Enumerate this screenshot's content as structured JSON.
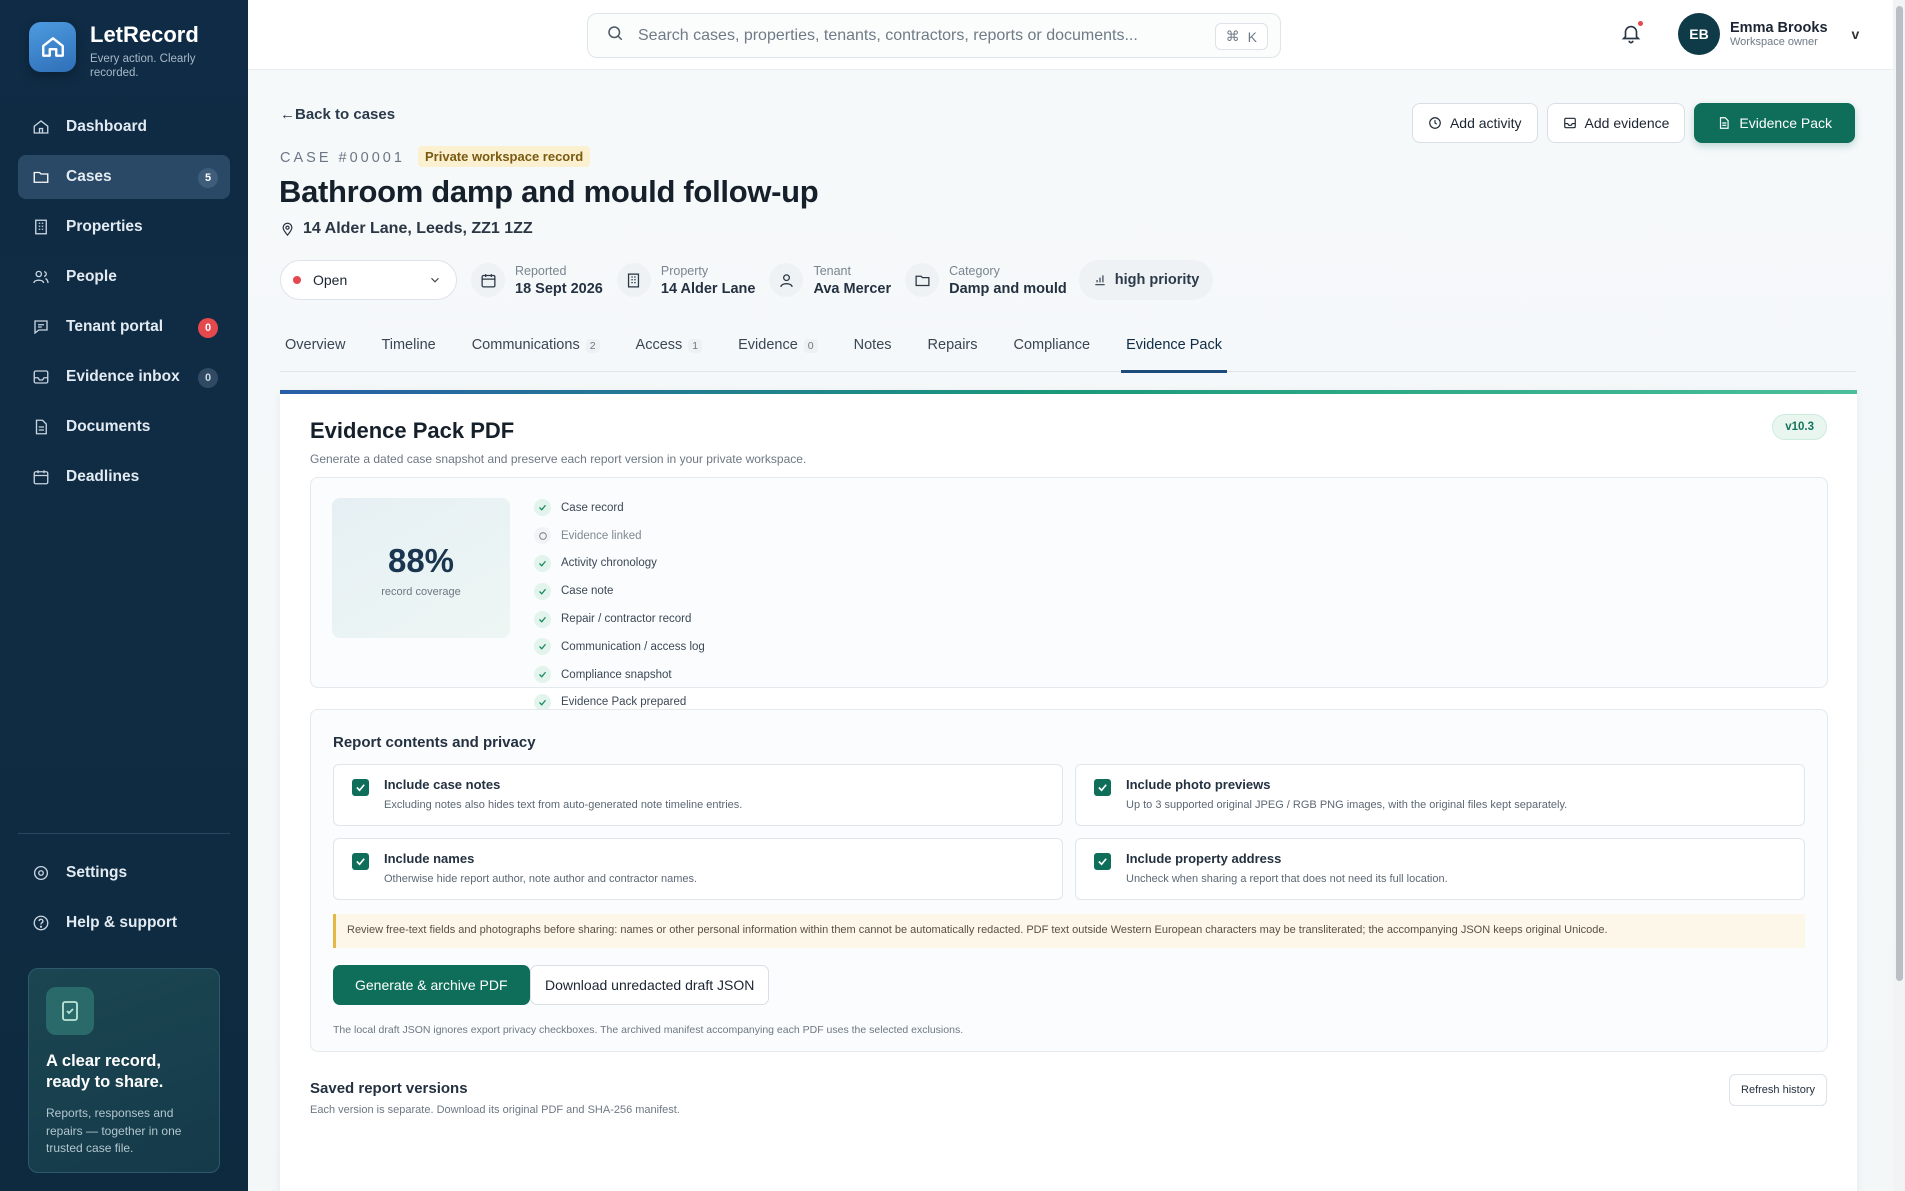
{
  "brand": {
    "name": "LetRecord",
    "tagline": "Every action. Clearly recorded."
  },
  "sidebar": {
    "items": [
      {
        "label": "Dashboard",
        "icon": "home-icon"
      },
      {
        "label": "Cases",
        "icon": "folder-icon",
        "count": "5",
        "active": true
      },
      {
        "label": "Properties",
        "icon": "building-icon"
      },
      {
        "label": "People",
        "icon": "users-icon"
      },
      {
        "label": "Tenant portal",
        "icon": "message-icon",
        "count": "0"
      },
      {
        "label": "Evidence inbox",
        "icon": "inbox-icon",
        "count": "0"
      },
      {
        "label": "Documents",
        "icon": "document-icon"
      },
      {
        "label": "Deadlines",
        "icon": "calendar-icon"
      }
    ],
    "footer_items": [
      {
        "label": "Settings",
        "icon": "gear-icon"
      },
      {
        "label": "Help & support",
        "icon": "help-icon"
      }
    ],
    "promo": {
      "title": "A clear record, ready to share.",
      "text": "Reports, responses and repairs — together in one trusted case file."
    }
  },
  "topbar": {
    "search_placeholder": "Search cases, properties, tenants, contractors, reports or documents...",
    "shortcut_symbol": "⌘",
    "shortcut_key": "K",
    "user": {
      "initials": "EB",
      "name": "Emma Brooks",
      "role": "Workspace owner",
      "caret": "v"
    }
  },
  "page": {
    "back_label": "Back to cases",
    "actions": {
      "add_activity": "Add activity",
      "add_evidence": "Add evidence",
      "evidence_pack": "Evidence Pack"
    },
    "case_id": "CASE #00001",
    "case_badge": "Private workspace record",
    "title": "Bathroom damp and mould follow-up",
    "address": "14 Alder Lane, Leeds, ZZ1 1ZZ",
    "status": "Open",
    "meta": {
      "reported_label": "Reported",
      "reported_value": "18 Sept 2026",
      "property_label": "Property",
      "property_value": "14 Alder Lane",
      "tenant_label": "Tenant",
      "tenant_value": "Ava Mercer",
      "category_label": "Category",
      "category_value": "Damp and mould"
    },
    "priority": "high priority",
    "tabs": [
      {
        "label": "Overview"
      },
      {
        "label": "Timeline"
      },
      {
        "label": "Communications",
        "count": "2"
      },
      {
        "label": "Access",
        "count": "1"
      },
      {
        "label": "Evidence",
        "count": "0"
      },
      {
        "label": "Notes"
      },
      {
        "label": "Repairs"
      },
      {
        "label": "Compliance"
      },
      {
        "label": "Evidence Pack",
        "active": true
      }
    ]
  },
  "pack": {
    "title": "Evidence Pack PDF",
    "subtitle": "Generate a dated case snapshot and preserve each report version in your private workspace.",
    "version": "v10.3",
    "coverage_pct": "88%",
    "coverage_label": "record coverage",
    "checklist": [
      {
        "label": "Case record",
        "done": true
      },
      {
        "label": "Evidence linked",
        "done": false
      },
      {
        "label": "Activity chronology",
        "done": true
      },
      {
        "label": "Case note",
        "done": true
      },
      {
        "label": "Repair / contractor record",
        "done": true
      },
      {
        "label": "Communication / access log",
        "done": true
      },
      {
        "label": "Compliance snapshot",
        "done": true
      },
      {
        "label": "Evidence Pack prepared",
        "done": true
      }
    ],
    "privacy": {
      "title": "Report contents and privacy",
      "options": [
        {
          "title": "Include case notes",
          "desc": "Excluding notes also hides text from auto-generated note timeline entries."
        },
        {
          "title": "Include photo previews",
          "desc": "Up to 3 supported original JPEG / RGB PNG images, with the original files kept separately."
        },
        {
          "title": "Include names",
          "desc": "Otherwise hide report author, note author and contractor names."
        },
        {
          "title": "Include property address",
          "desc": "Uncheck when sharing a report that does not need its full location."
        }
      ],
      "warning": "Review free-text fields and photographs before sharing: names or other personal information within them cannot be automatically redacted. PDF text outside Western European characters may be transliterated; the accompanying JSON keeps original Unicode.",
      "generate_label": "Generate & archive PDF",
      "download_label": "Download unredacted draft JSON",
      "note": "The local draft JSON ignores export privacy checkboxes. The archived manifest accompanying each PDF uses the selected exclusions."
    },
    "saved": {
      "title": "Saved report versions",
      "subtitle": "Each version is separate. Download its original PDF and SHA-256 manifest.",
      "refresh_label": "Refresh history"
    }
  },
  "colors": {
    "sidebar_bg": "#0f2b45",
    "accent": "#0e6e5a",
    "alert": "#e5484d",
    "badge_bg": "#fbf0cf"
  }
}
